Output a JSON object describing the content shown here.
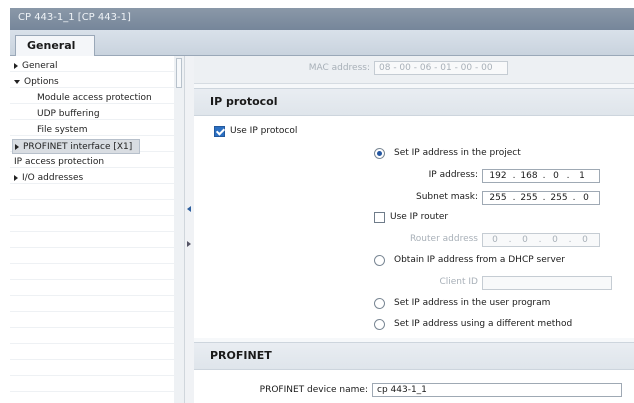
{
  "window": {
    "title": "CP 443-1_1 [CP 443-1]"
  },
  "tabs": [
    {
      "label": "General"
    }
  ],
  "nav": {
    "items": [
      {
        "label": "General"
      },
      {
        "label": "Options"
      },
      {
        "label": "Module access protection"
      },
      {
        "label": "UDP buffering"
      },
      {
        "label": "File system"
      },
      {
        "label": "PROFINET interface [X1]"
      },
      {
        "label": "IP access protection"
      },
      {
        "label": "I/O addresses"
      }
    ]
  },
  "mac": {
    "label": "MAC address:",
    "value": "08 - 00 - 06 - 01 - 00 - 00"
  },
  "ip_protocol": {
    "header": "IP protocol",
    "use_ip_protocol": "Use IP protocol",
    "set_in_project": "Set IP address in the project",
    "ip_address_label": "IP address:",
    "ip_address": [
      "192",
      "168",
      "0",
      "1"
    ],
    "subnet_mask_label": "Subnet mask:",
    "subnet_mask": [
      "255",
      "255",
      "255",
      "0"
    ],
    "use_ip_router": "Use IP router",
    "router_address_label": "Router address",
    "router_address": [
      "0",
      "0",
      "0",
      "0"
    ],
    "obtain_dhcp": "Obtain IP address from a DHCP server",
    "client_id_label": "Client ID",
    "client_id": "",
    "set_user_program": "Set IP address in the user program",
    "set_different_method": "Set IP address using a different method"
  },
  "profinet": {
    "header": "PROFINET",
    "device_name_label": "PROFINET device name:",
    "device_name": "cp 443-1_1"
  }
}
